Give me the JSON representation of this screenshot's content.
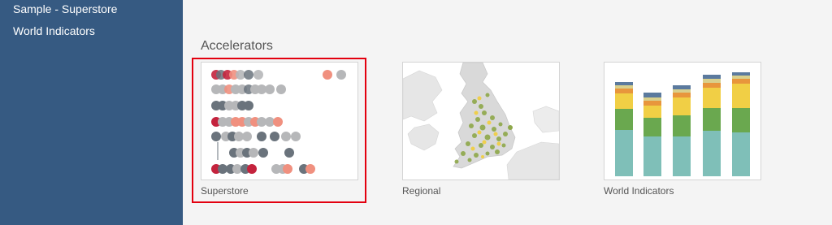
{
  "sidebar": {
    "items": [
      {
        "label": "Sample - Superstore"
      },
      {
        "label": "World Indicators"
      }
    ]
  },
  "main": {
    "section_title": "Accelerators",
    "cards": [
      {
        "label": "Superstore",
        "thumbnail": "dot-plot-thumbnail",
        "selected": true
      },
      {
        "label": "Regional",
        "thumbnail": "uk-map-thumbnail",
        "selected": false
      },
      {
        "label": "World Indicators",
        "thumbnail": "stacked-bar-thumbnail",
        "selected": false
      }
    ]
  },
  "colors": {
    "sidebar_bg": "#365a82",
    "highlight_border": "#e3000f",
    "dot_red": "#c4233d",
    "dot_salmon": "#f0907f",
    "dot_gray": "#b6b7b9",
    "dot_dark": "#6a737c",
    "bar_teal": "#7fbfb8",
    "bar_green": "#6aa84f",
    "bar_yellow": "#f1cf45",
    "bar_orange": "#e8963c",
    "bar_slate": "#5b7a9e"
  }
}
